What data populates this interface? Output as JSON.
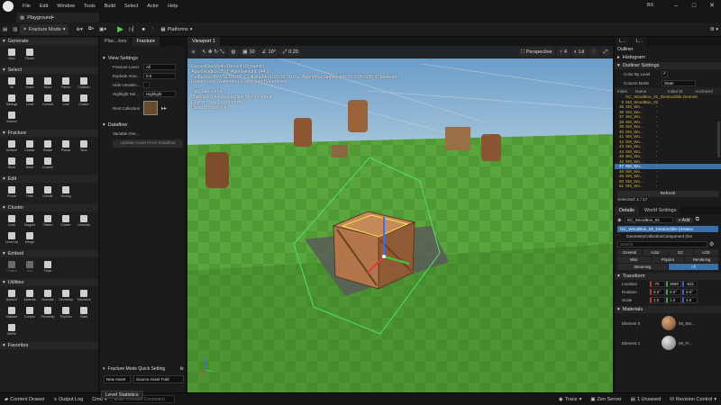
{
  "menu": {
    "items": [
      "File",
      "Edit",
      "Window",
      "Tools",
      "Build",
      "Select",
      "Actor",
      "Help"
    ],
    "project_tab": "Playground•",
    "window_badge": "BX"
  },
  "toolbar": {
    "mode_label": "Fracture Mode",
    "platforms_label": "Platforms"
  },
  "left_panel": {
    "sections": [
      {
        "title": "Generate",
        "tools": [
          "New",
          "Reset"
        ],
        "dim": []
      },
      {
        "title": "Select",
        "tools": [
          "All",
          "Invert",
          "None",
          "Parent",
          "Children",
          "Siblings",
          "Level",
          "Contact",
          "Leaf",
          "Cluster",
          "Volume"
        ],
        "dim": []
      },
      {
        "title": "Fracture",
        "tools": [
          "Uniform",
          "Cluster",
          "Radial",
          "Planar",
          "Slice",
          "Brick",
          "Mesh",
          "Custom"
        ],
        "dim": []
      },
      {
        "title": "Edit",
        "tools": [
          "Prune",
          "Hide",
          "Unhide",
          "Geolog"
        ],
        "dim": []
      },
      {
        "title": "Cluster",
        "tools": [
          "Auto",
          "Magnet",
          "Flatten",
          "Cluster",
          "Uncluste",
          "Level Up",
          "Merge"
        ],
        "dim": []
      },
      {
        "title": "Embed",
        "tools": [
          "Embed",
          "Add",
          "Flush"
        ],
        "dim": [
          "Embed",
          "Add"
        ]
      },
      {
        "title": "Utilities",
        "tools": [
          "AutoUV",
          "Material",
          "Normals",
          "Geometry",
          "Tolerance",
          "Validate",
          "Convex",
          "Proximity",
          "TinyGeo",
          "State",
          "SetRe"
        ],
        "dim": []
      },
      {
        "title": "Favorites",
        "tools": [],
        "dim": []
      }
    ]
  },
  "mid_panel": {
    "tabs": [
      "Plac...tors",
      "Fracture"
    ],
    "view_settings_title": "View Settings",
    "rows": [
      {
        "key": "Fracture Level",
        "value": "All"
      },
      {
        "key": "Explode Amo...",
        "value": "0.0"
      },
      {
        "key": "Hide Unselec...",
        "value": ""
      },
      {
        "key": "Highlight Sel...",
        "value": "Highlight"
      },
      {
        "key": "Rest Collection",
        "value": ""
      }
    ],
    "dataflow_title": "Dataflow",
    "dataflow_row": "Variable Ove...",
    "dataflow_button": "Update Asset From Dataflow",
    "quick_settings": "Fracture Mode Quick Setting",
    "new_asset": "New Asset",
    "source_asset": "Source Asset Fold"
  },
  "viewport": {
    "tab": "Viewport 1",
    "perspective": "Perspective",
    "lit": "Lit",
    "snap_grid": "10",
    "snap_rot": "10°",
    "snap_scale": "0.25",
    "cam_speed": "4",
    "stats": [
      "RecastNavMesh-Default (Dynamic)",
      "AgentRadius 35.0, AgentHeight 144.0",
      "CellSizes 38.0/19.0/19.0, CellHeights 10.0/10.0/10.0, AgentMaxStepHeight 35.0/35.0/35.0 (beneath)",
      "Region part Watershed, Layer part Watershed",
      "",
      "NavData count: 1",
      "MainNavData: RecastNavMesh-Default",
      "Custom NavLinks count: 0",
      "Using cluster links"
    ],
    "sky_color": "#7aa9cf",
    "grass_color": "#4f9a34"
  },
  "outliner": {
    "tabs": [
      "L...",
      "L..."
    ],
    "title": "Outliner",
    "histogram": "Histogram",
    "settings_title": "Outliner Settings",
    "color_by_level": "Color By Level",
    "column_mode_key": "Column Mode",
    "column_mode_value": "State",
    "headers": [
      "Index",
      "Name",
      "Initial St",
      "Anchored"
    ],
    "rows": [
      {
        "i": "",
        "name": "GC_WoodBox_02_Destructible.Geomet"
      },
      {
        "i": "0",
        "name": "SM_WoodBox_02"
      },
      {
        "i": "35",
        "name": "SM_Wo..."
      },
      {
        "i": "36",
        "name": "SM_Wo..."
      },
      {
        "i": "37",
        "name": "SM_Wo..."
      },
      {
        "i": "38",
        "name": "SM_Wo..."
      },
      {
        "i": "39",
        "name": "SM_Wo..."
      },
      {
        "i": "40",
        "name": "SM_Wo..."
      },
      {
        "i": "41",
        "name": "SM_Wo..."
      },
      {
        "i": "42",
        "name": "SM_Wo..."
      },
      {
        "i": "43",
        "name": "SM_Wo..."
      },
      {
        "i": "44",
        "name": "SM_Wo..."
      },
      {
        "i": "45",
        "name": "SM_Wo..."
      },
      {
        "i": "46",
        "name": "SM_Wo..."
      },
      {
        "i": "47",
        "name": "SM_Wo..."
      },
      {
        "i": "48",
        "name": "SM_Wo..."
      },
      {
        "i": "49",
        "name": "SM_Wo..."
      },
      {
        "i": "50",
        "name": "SM_Wo..."
      },
      {
        "i": "51",
        "name": "SM_Wo..."
      }
    ],
    "selected_index": 14,
    "refresh": "Refresh",
    "selected_count": "Selected: 1 / 17"
  },
  "details": {
    "tabs": [
      "Details",
      "World Settings"
    ],
    "actor_name": "GC_WoodBox_02",
    "add_label": "+ Add",
    "component_root": "GC_WoodBox_02_Destructible (Instanc",
    "component_child": "GeometryCollectionComponent (Ge",
    "search_placeholder": "Search",
    "filters_row1": [
      "General",
      "Actor",
      "GC",
      "LOD"
    ],
    "filters_row2": [
      "Misc",
      "Physics",
      "Rendering"
    ],
    "filters_row3": [
      "Streaming",
      "All"
    ],
    "transform_title": "Transform",
    "location": {
      "label": "Location",
      "x": "-70",
      "y": "3680",
      "z": "-621"
    },
    "rotation": {
      "label": "Rotation",
      "x": "0.0°",
      "y": "0.0°",
      "z": "0.0°"
    },
    "scale": {
      "label": "Scale",
      "x": "1.0",
      "y": "1.0",
      "z": "1.0"
    },
    "materials_title": "Materials",
    "element0": "Element 0",
    "element1": "Element 1",
    "mat0": "MI_Wo...",
    "mat1": "MI_Fr..."
  },
  "statusbar": {
    "content_drawer": "Content Drawer",
    "output_log": "Output Log",
    "cmd": "Cmd",
    "cmd_placeholder": "Enter Console Command",
    "trace": "Trace",
    "zen_server": "Zen Server",
    "unsaved": "1 Unsaved",
    "revision_control": "Revision Control",
    "level_stats": "Level Statistics"
  }
}
